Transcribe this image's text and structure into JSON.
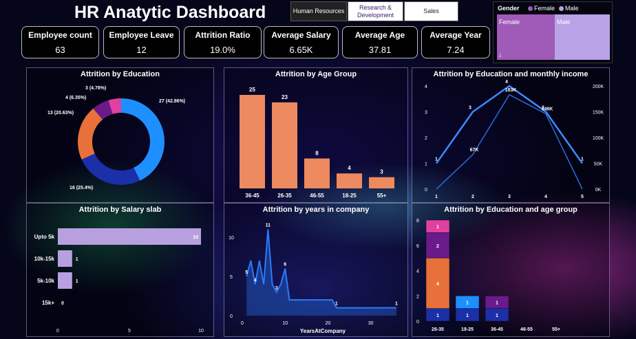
{
  "header": {
    "title": "HR Anatytic Dashboard"
  },
  "nav": [
    {
      "label": "Human Resources",
      "active": true
    },
    {
      "label": "Research & Development",
      "active": false
    },
    {
      "label": "Sales",
      "active": false
    }
  ],
  "gender": {
    "title": "Gender",
    "legend": [
      "Female",
      "Male"
    ],
    "colors": {
      "female": "#a05ab8",
      "male": "#b9a2e6"
    },
    "female_label": "Female",
    "male_label": "Male",
    "female_small": "2"
  },
  "kpis": [
    {
      "label": "Employee count",
      "value": "63"
    },
    {
      "label": "Employee Leave",
      "value": "12"
    },
    {
      "label": "Attrition Ratio",
      "value": "19.0%"
    },
    {
      "label": "Average Salary",
      "value": "6.65K"
    },
    {
      "label": "Average Age",
      "value": "37.81"
    },
    {
      "label": "Average Year",
      "value": "7.24"
    }
  ],
  "panels": {
    "education": "Attrition by Education",
    "age_group": "Attrition by Age Group",
    "edu_income": "Attrition by Education and monthly income",
    "salary_slab": "Attrition by Salary slab",
    "years": "Attrition by years in company",
    "edu_age": "Attrition by Education and age group"
  },
  "chart_data": [
    {
      "id": "education",
      "type": "pie",
      "title": "Attrition by Education",
      "slices": [
        {
          "value": 27,
          "label": "27 (42.86%)",
          "color": "#1e8fff"
        },
        {
          "value": 16,
          "label": "16 (25.4%)",
          "color": "#1a2fa8"
        },
        {
          "value": 13,
          "label": "13 (20.63%)",
          "color": "#e8703a"
        },
        {
          "value": 4,
          "label": "4 (6.35%)",
          "color": "#6a1a8a"
        },
        {
          "value": 3,
          "label": "3 (4.76%)",
          "color": "#e040a0"
        }
      ]
    },
    {
      "id": "age_group",
      "type": "bar",
      "title": "Attrition by Age Group",
      "categories": [
        "36-45",
        "26-35",
        "46-55",
        "18-25",
        "55+"
      ],
      "values": [
        25,
        23,
        8,
        4,
        3
      ],
      "color": "#ee8a60"
    },
    {
      "id": "edu_income",
      "type": "line",
      "title": "Attrition by Education and monthly income",
      "x": [
        1,
        2,
        3,
        4,
        5
      ],
      "series": [
        {
          "values": [
            1,
            3,
            4,
            3,
            1
          ],
          "axis": "left"
        },
        {
          "values": [
            0,
            67,
            183,
            146,
            0
          ],
          "axis": "right",
          "labels": [
            "",
            "67K",
            "183K",
            "146K",
            ""
          ]
        }
      ],
      "ylim_left": [
        0,
        4
      ],
      "yticks_left": [
        "0",
        "1",
        "2",
        "3",
        "4"
      ],
      "yticks_right": [
        "0K",
        "50K",
        "100K",
        "150K",
        "200K"
      ],
      "ylim_right": [
        0,
        200
      ]
    },
    {
      "id": "salary_slab",
      "type": "bar",
      "title": "Attrition by Salary slab",
      "categories": [
        "Upto 5k",
        "10k-15k",
        "5k-10k",
        "15k+"
      ],
      "values": [
        10,
        1,
        1,
        0
      ],
      "xticks": [
        "0",
        "5",
        "10"
      ],
      "xlim": [
        0,
        10
      ],
      "color": "#b8a0e0"
    },
    {
      "id": "years",
      "type": "area",
      "title": "Attrition by years in company",
      "xlabel": "YearsAtCompany",
      "x": [
        1,
        2,
        3,
        4,
        5,
        6,
        7,
        8,
        9,
        10,
        11,
        12,
        13,
        14,
        15,
        16,
        17,
        18,
        19,
        20,
        21,
        22,
        23,
        24,
        25,
        26,
        27,
        28,
        29,
        30,
        31,
        32,
        33,
        34,
        35,
        36
      ],
      "values": [
        5,
        7,
        4,
        7,
        4,
        11,
        4,
        3,
        4,
        6,
        2,
        2,
        2,
        2,
        2,
        2,
        2,
        2,
        2,
        2,
        2,
        1,
        1,
        1,
        1,
        1,
        1,
        1,
        1,
        1,
        1,
        1,
        1,
        1,
        1,
        1
      ],
      "point_labels": [
        {
          "x": 1,
          "y": 5,
          "label": "5"
        },
        {
          "x": 3,
          "y": 4,
          "label": "4"
        },
        {
          "x": 6,
          "y": 11,
          "label": "11"
        },
        {
          "x": 8,
          "y": 3,
          "label": "3"
        },
        {
          "x": 10,
          "y": 6,
          "label": "6"
        },
        {
          "x": 22,
          "y": 1,
          "label": "1"
        },
        {
          "x": 36,
          "y": 1,
          "label": "1"
        }
      ],
      "xticks": [
        "0",
        "10",
        "20",
        "30"
      ],
      "yticks": [
        "0",
        "5",
        "10"
      ],
      "ylim": [
        0,
        12
      ],
      "xlim": [
        0,
        36
      ],
      "color": "#2a7bff"
    },
    {
      "id": "edu_age",
      "type": "bar",
      "title": "Attrition by Education and age group",
      "stacked": true,
      "categories": [
        "26-35",
        "18-25",
        "36-45",
        "46-55",
        "55+"
      ],
      "series": [
        {
          "color": "#1a2fa8",
          "values": [
            1,
            1,
            1,
            0,
            0
          ]
        },
        {
          "color": "#1e8fff",
          "values": [
            0,
            1,
            0,
            0,
            0
          ]
        },
        {
          "color": "#e8703a",
          "values": [
            4,
            0,
            0,
            0,
            0
          ]
        },
        {
          "color": "#6a1a8a",
          "values": [
            2,
            0,
            1,
            0,
            0
          ]
        },
        {
          "color": "#e040a0",
          "values": [
            1,
            0,
            0,
            0,
            0
          ]
        }
      ],
      "yticks": [
        "0",
        "2",
        "4",
        "6",
        "8"
      ],
      "ylim": [
        0,
        8
      ]
    }
  ]
}
